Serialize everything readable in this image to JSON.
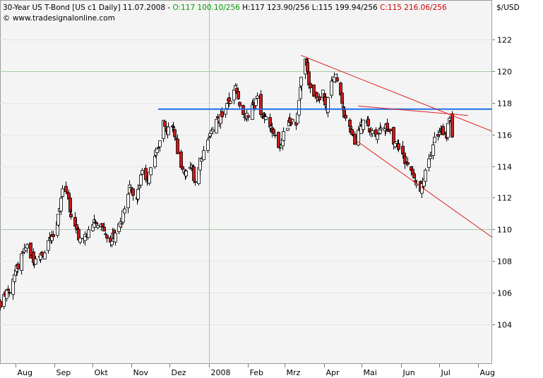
{
  "header": {
    "title": "30-Year US T-Bond [US c1  Daily] 11.07.2008",
    "sep1": " - ",
    "open": "O:117 100.10/256",
    "high": " H:117 123.90/256",
    "low": " L:115 199.94/256",
    "close": " C:115 216.06/256",
    "watermark": "© www.tradesignalonline.com",
    "unit": "$/USD",
    "colors": {
      "open": "#009900",
      "close": "#cc0000",
      "text": "#000000"
    }
  },
  "chart_data": {
    "type": "candlestick",
    "ylim": [
      101.5,
      124.5
    ],
    "yticks": [
      104,
      106,
      108,
      110,
      112,
      114,
      116,
      118,
      120,
      122
    ],
    "ylabel": "$/USD",
    "x_range": [
      "2007-07-20",
      "2008-08-12"
    ],
    "x_months": [
      {
        "date": "2007-08-01",
        "label": "Aug"
      },
      {
        "date": "2007-09-01",
        "label": "Sep"
      },
      {
        "date": "2007-10-01",
        "label": "Okt"
      },
      {
        "date": "2007-11-01",
        "label": "Nov"
      },
      {
        "date": "2007-12-01",
        "label": "Dez"
      },
      {
        "date": "2008-01-01",
        "label": "2008"
      },
      {
        "date": "2008-02-01",
        "label": "Feb"
      },
      {
        "date": "2008-03-01",
        "label": "Mrz"
      },
      {
        "date": "2008-04-01",
        "label": "Apr"
      },
      {
        "date": "2008-05-01",
        "label": "Mai"
      },
      {
        "date": "2008-06-01",
        "label": "Jun"
      },
      {
        "date": "2008-07-01",
        "label": "Jul"
      },
      {
        "date": "2008-08-01",
        "label": "Aug"
      }
    ],
    "highlight_gridlines": {
      "y": [
        110,
        120
      ],
      "x": [
        "2008-01-01"
      ]
    },
    "close_anchors": [
      [
        "2007-07-20",
        105.3
      ],
      [
        "2007-07-26",
        106.0
      ],
      [
        "2007-08-02",
        107.5
      ],
      [
        "2007-08-06",
        108.4
      ],
      [
        "2007-08-10",
        109.0
      ],
      [
        "2007-08-16",
        107.8
      ],
      [
        "2007-08-22",
        108.3
      ],
      [
        "2007-08-29",
        109.4
      ],
      [
        "2007-09-03",
        110.2
      ],
      [
        "2007-09-07",
        112.7
      ],
      [
        "2007-09-10",
        112.4
      ],
      [
        "2007-09-14",
        111.0
      ],
      [
        "2007-09-18",
        110.2
      ],
      [
        "2007-09-21",
        109.2
      ],
      [
        "2007-09-28",
        110.0
      ],
      [
        "2007-10-04",
        110.6
      ],
      [
        "2007-10-09",
        110.0
      ],
      [
        "2007-10-15",
        109.4
      ],
      [
        "2007-10-19",
        109.6
      ],
      [
        "2007-10-24",
        110.6
      ],
      [
        "2007-10-30",
        112.8
      ],
      [
        "2007-11-05",
        112.0
      ],
      [
        "2007-11-09",
        113.6
      ],
      [
        "2007-11-14",
        113.2
      ],
      [
        "2007-11-19",
        114.8
      ],
      [
        "2007-11-23",
        115.6
      ],
      [
        "2007-11-26",
        117.0
      ],
      [
        "2007-11-28",
        116.0
      ],
      [
        "2007-12-04",
        116.6
      ],
      [
        "2007-12-07",
        115.0
      ],
      [
        "2007-12-10",
        114.0
      ],
      [
        "2007-12-14",
        113.6
      ],
      [
        "2007-12-18",
        114.2
      ],
      [
        "2007-12-21",
        112.8
      ],
      [
        "2007-12-24",
        114.0
      ],
      [
        "2007-12-28",
        115.0
      ],
      [
        "2008-01-04",
        116.4
      ],
      [
        "2008-01-10",
        117.0
      ],
      [
        "2008-01-16",
        118.0
      ],
      [
        "2008-01-22",
        119.0
      ],
      [
        "2008-01-25",
        117.8
      ],
      [
        "2008-01-29",
        117.0
      ],
      [
        "2008-02-04",
        117.6
      ],
      [
        "2008-02-08",
        118.2
      ],
      [
        "2008-02-13",
        117.0
      ],
      [
        "2008-02-19",
        116.6
      ],
      [
        "2008-02-25",
        115.0
      ],
      [
        "2008-02-29",
        116.2
      ],
      [
        "2008-03-04",
        116.8
      ],
      [
        "2008-03-10",
        116.6
      ],
      [
        "2008-03-13",
        119.2
      ],
      [
        "2008-03-17",
        120.6
      ],
      [
        "2008-03-20",
        119.4
      ],
      [
        "2008-03-26",
        118.2
      ],
      [
        "2008-03-31",
        118.8
      ],
      [
        "2008-04-03",
        117.8
      ],
      [
        "2008-04-07",
        119.4
      ],
      [
        "2008-04-10",
        119.8
      ],
      [
        "2008-04-14",
        118.4
      ],
      [
        "2008-04-18",
        117.0
      ],
      [
        "2008-04-22",
        116.2
      ],
      [
        "2008-04-25",
        115.6
      ],
      [
        "2008-04-30",
        116.6
      ],
      [
        "2008-05-05",
        116.8
      ],
      [
        "2008-05-09",
        116.0
      ],
      [
        "2008-05-13",
        115.8
      ],
      [
        "2008-05-16",
        116.6
      ],
      [
        "2008-05-21",
        116.4
      ],
      [
        "2008-05-26",
        115.6
      ],
      [
        "2008-05-30",
        115.2
      ],
      [
        "2008-06-04",
        114.2
      ],
      [
        "2008-06-09",
        113.6
      ],
      [
        "2008-06-12",
        112.8
      ],
      [
        "2008-06-16",
        112.4
      ],
      [
        "2008-06-19",
        113.4
      ],
      [
        "2008-06-24",
        114.4
      ],
      [
        "2008-06-27",
        115.6
      ],
      [
        "2008-07-02",
        116.2
      ],
      [
        "2008-07-07",
        116.0
      ],
      [
        "2008-07-09",
        117.2
      ],
      [
        "2008-07-11",
        115.84
      ]
    ],
    "series": [
      {
        "name": "",
        "kind": "horizontal",
        "color": "#1e6ee8",
        "points": [
          [
            "2007-11-22",
            117.6
          ],
          [
            "2008-08-12",
            117.6
          ]
        ]
      },
      {
        "name": "",
        "kind": "trend",
        "color": "#e02020",
        "points": [
          [
            "2008-03-14",
            121.0
          ],
          [
            "2008-08-12",
            116.2
          ]
        ]
      },
      {
        "name": "",
        "kind": "trend",
        "color": "#e02020",
        "points": [
          [
            "2008-04-25",
            115.7
          ],
          [
            "2008-08-12",
            109.5
          ]
        ]
      },
      {
        "name": "",
        "kind": "trend",
        "color": "#e02020",
        "points": [
          [
            "2008-04-28",
            117.8
          ],
          [
            "2008-07-24",
            117.2
          ]
        ]
      }
    ]
  }
}
